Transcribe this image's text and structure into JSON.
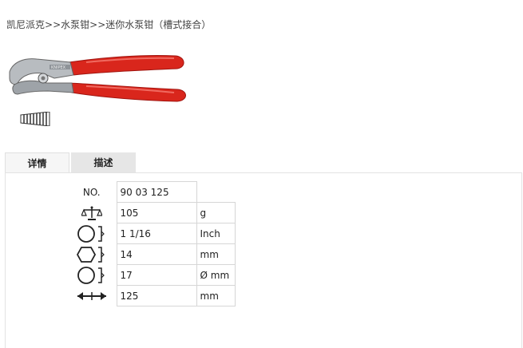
{
  "breadcrumb": {
    "items": [
      "凯尼派克",
      "水泵钳",
      "迷你水泵钳（槽式接合）"
    ],
    "separator": ">>"
  },
  "product": {
    "image_icon": "water-pump-pliers-red-handles",
    "brand_marking": "KNIPEX"
  },
  "tabs": [
    {
      "label": "详情",
      "active": true
    },
    {
      "label": "描述",
      "active": false
    }
  ],
  "specs": [
    {
      "label": "NO.",
      "icon": "",
      "value": "90 03 125",
      "unit": ""
    },
    {
      "label": "",
      "icon": "weight-scale-icon",
      "value": "105",
      "unit": "g"
    },
    {
      "label": "",
      "icon": "round-pipe-capacity-icon",
      "value": "1 1/16",
      "unit": "Inch"
    },
    {
      "label": "",
      "icon": "hex-nut-capacity-icon",
      "value": "14",
      "unit": "mm"
    },
    {
      "label": "",
      "icon": "round-diameter-capacity-icon",
      "value": "17",
      "unit": "Ø mm"
    },
    {
      "label": "",
      "icon": "length-arrow-icon",
      "value": "125",
      "unit": "mm"
    }
  ],
  "colors": {
    "handle_red": "#d9261c",
    "tab_active_bg": "#f6f6f6",
    "tab_inactive_bg": "#e6e6e6"
  }
}
